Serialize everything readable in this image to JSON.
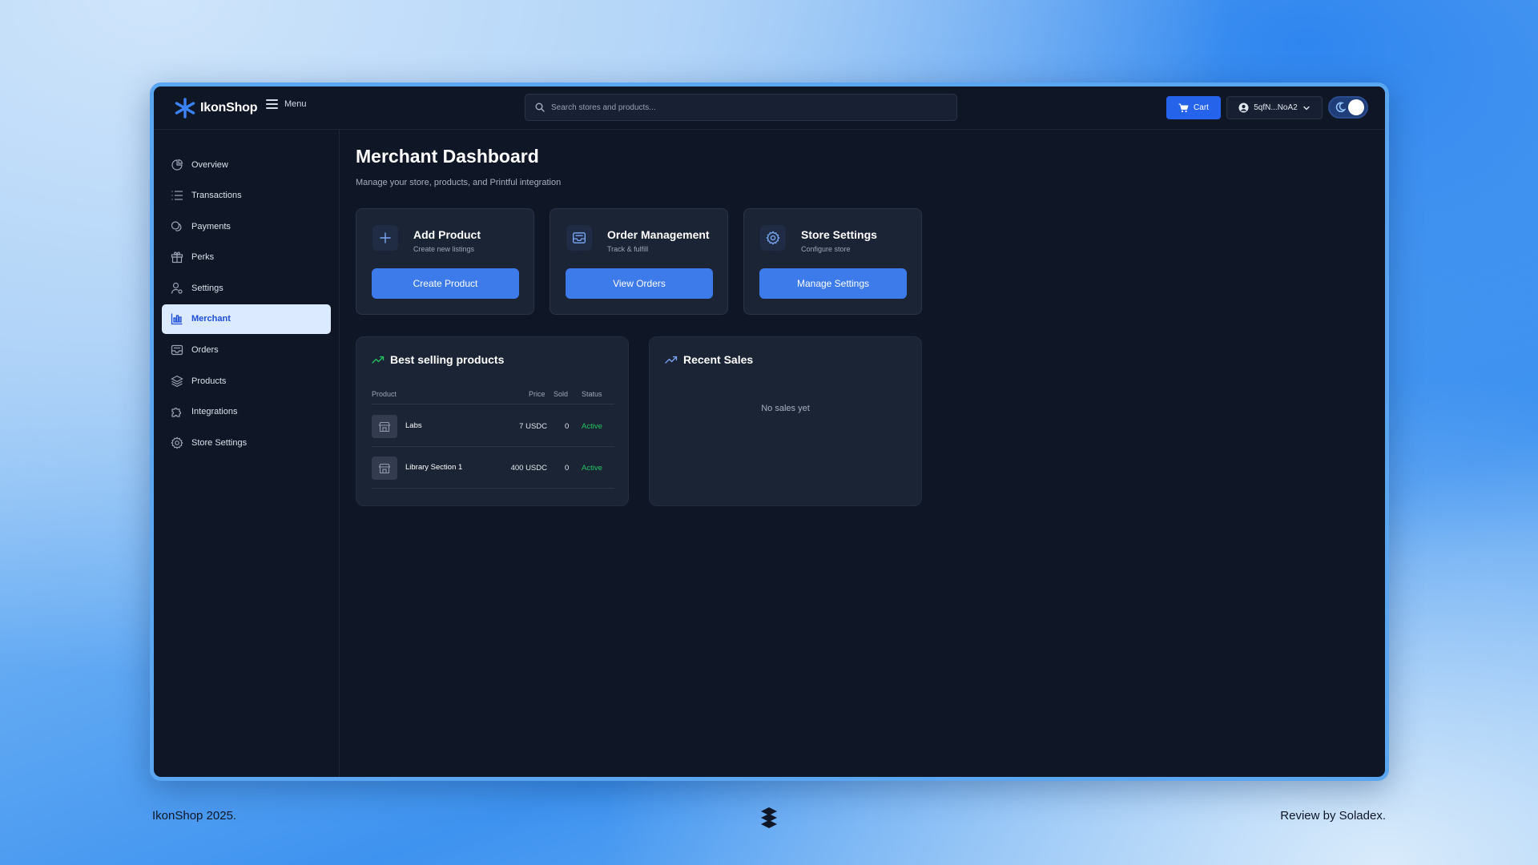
{
  "app": {
    "name": "IkonShop",
    "menu_label": "Menu",
    "search_placeholder": "Search stores and products...",
    "cart_label": "Cart",
    "wallet_label": "5qfN...NoA2"
  },
  "sidebar": {
    "items": [
      {
        "label": "Overview",
        "icon": "pie-chart-icon"
      },
      {
        "label": "Transactions",
        "icon": "list-icon"
      },
      {
        "label": "Payments",
        "icon": "coins-icon"
      },
      {
        "label": "Perks",
        "icon": "gift-icon"
      },
      {
        "label": "Settings",
        "icon": "user-settings-icon"
      },
      {
        "label": "Merchant",
        "icon": "bar-chart-icon",
        "active": true
      },
      {
        "label": "Orders",
        "icon": "inbox-icon"
      },
      {
        "label": "Products",
        "icon": "layers-icon"
      },
      {
        "label": "Integrations",
        "icon": "puzzle-icon"
      },
      {
        "label": "Store Settings",
        "icon": "gear-icon"
      }
    ]
  },
  "main": {
    "title": "Merchant Dashboard",
    "subtitle": "Manage your store, products, and Printful integration",
    "cards": [
      {
        "title": "Add Product",
        "subtitle": "Create new listings",
        "button": "Create Product",
        "icon": "plus-icon"
      },
      {
        "title": "Order Management",
        "subtitle": "Track & fulfill",
        "button": "View Orders",
        "icon": "inbox-icon"
      },
      {
        "title": "Store Settings",
        "subtitle": "Configure store",
        "button": "Manage Settings",
        "icon": "gear-icon"
      }
    ],
    "best_selling": {
      "title": "Best selling products",
      "columns": {
        "product": "Product",
        "price": "Price",
        "sold": "Sold",
        "status": "Status"
      },
      "rows": [
        {
          "product": "Labs",
          "price": "7 USDC",
          "sold": "0",
          "status": "Active"
        },
        {
          "product": "Library Section 1",
          "price": "400 USDC",
          "sold": "0",
          "status": "Active"
        }
      ]
    },
    "recent_sales": {
      "title": "Recent Sales",
      "empty": "No sales yet"
    }
  },
  "footer": {
    "left": "IkonShop 2025.",
    "right": "Review by Soladex."
  },
  "colors": {
    "accent": "#2563eb",
    "active_status": "#22c55e",
    "background": "#0f1626",
    "card": "#1b2435"
  }
}
